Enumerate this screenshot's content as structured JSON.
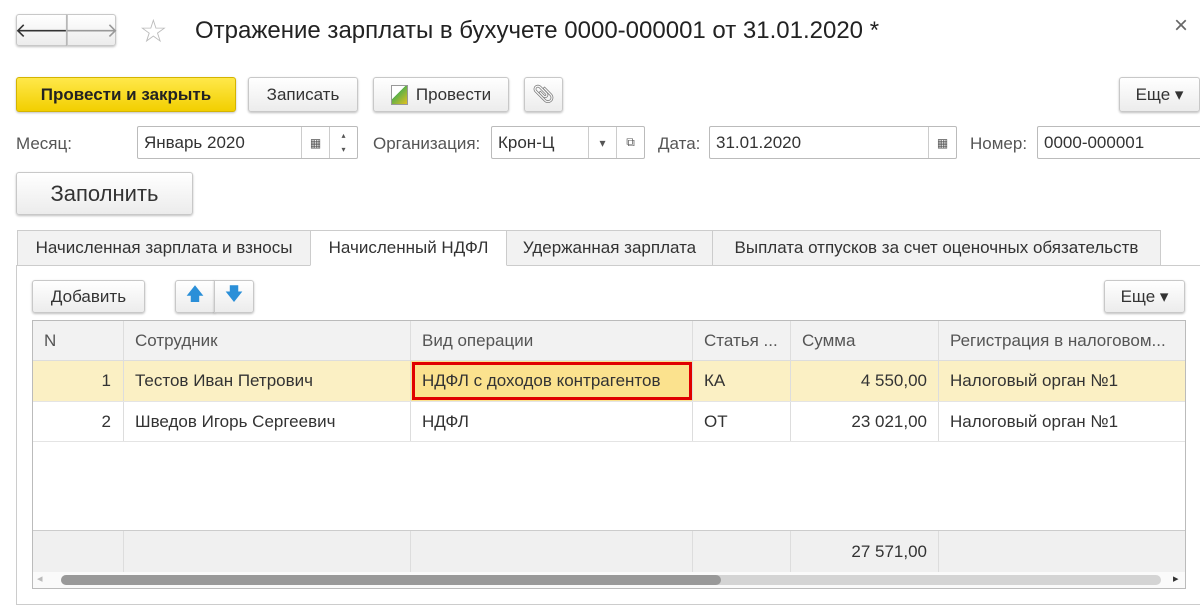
{
  "window": {
    "title": "Отражение зарплаты в бухучете 0000-000001 от 31.01.2020 *",
    "close": "×",
    "back": "🡐",
    "forward": "🡒",
    "star": "☆"
  },
  "toolbar": {
    "post_close": "Провести и закрыть",
    "save": "Записать",
    "post": "Провести",
    "more": "Еще ▾"
  },
  "fields": {
    "month_label": "Месяц:",
    "month_value": "Январь 2020",
    "org_label": "Организация:",
    "org_value": "Крон-Ц",
    "date_label": "Дата:",
    "date_value": "31.01.2020",
    "number_label": "Номер:",
    "number_value": "0000-000001"
  },
  "fill_button": "Заполнить",
  "tabs": [
    "Начисленная зарплата и взносы",
    "Начисленный НДФЛ",
    "Удержанная зарплата",
    "Выплата отпусков за счет оценочных обязательств"
  ],
  "table_toolbar": {
    "add": "Добавить",
    "more": "Еще ▾"
  },
  "table": {
    "columns": [
      "N",
      "Сотрудник",
      "Вид операции",
      "Статья ...",
      "Сумма",
      "Регистрация в налоговом..."
    ],
    "rows": [
      [
        "1",
        "Тестов Иван Петрович",
        "НДФЛ с доходов контрагентов",
        "КА",
        "4 550,00",
        "Налоговый орган №1"
      ],
      [
        "2",
        "Шведов Игорь Сергеевич",
        "НДФЛ",
        "ОТ",
        "23 021,00",
        "Налоговый орган №1"
      ]
    ],
    "total": "27 571,00"
  },
  "colors": {
    "accent": "#f5d800",
    "selected_row": "#fbf0c4",
    "highlight_border": "#e00000"
  },
  "scroll": {
    "horizontal_position_fraction": 0.6
  }
}
